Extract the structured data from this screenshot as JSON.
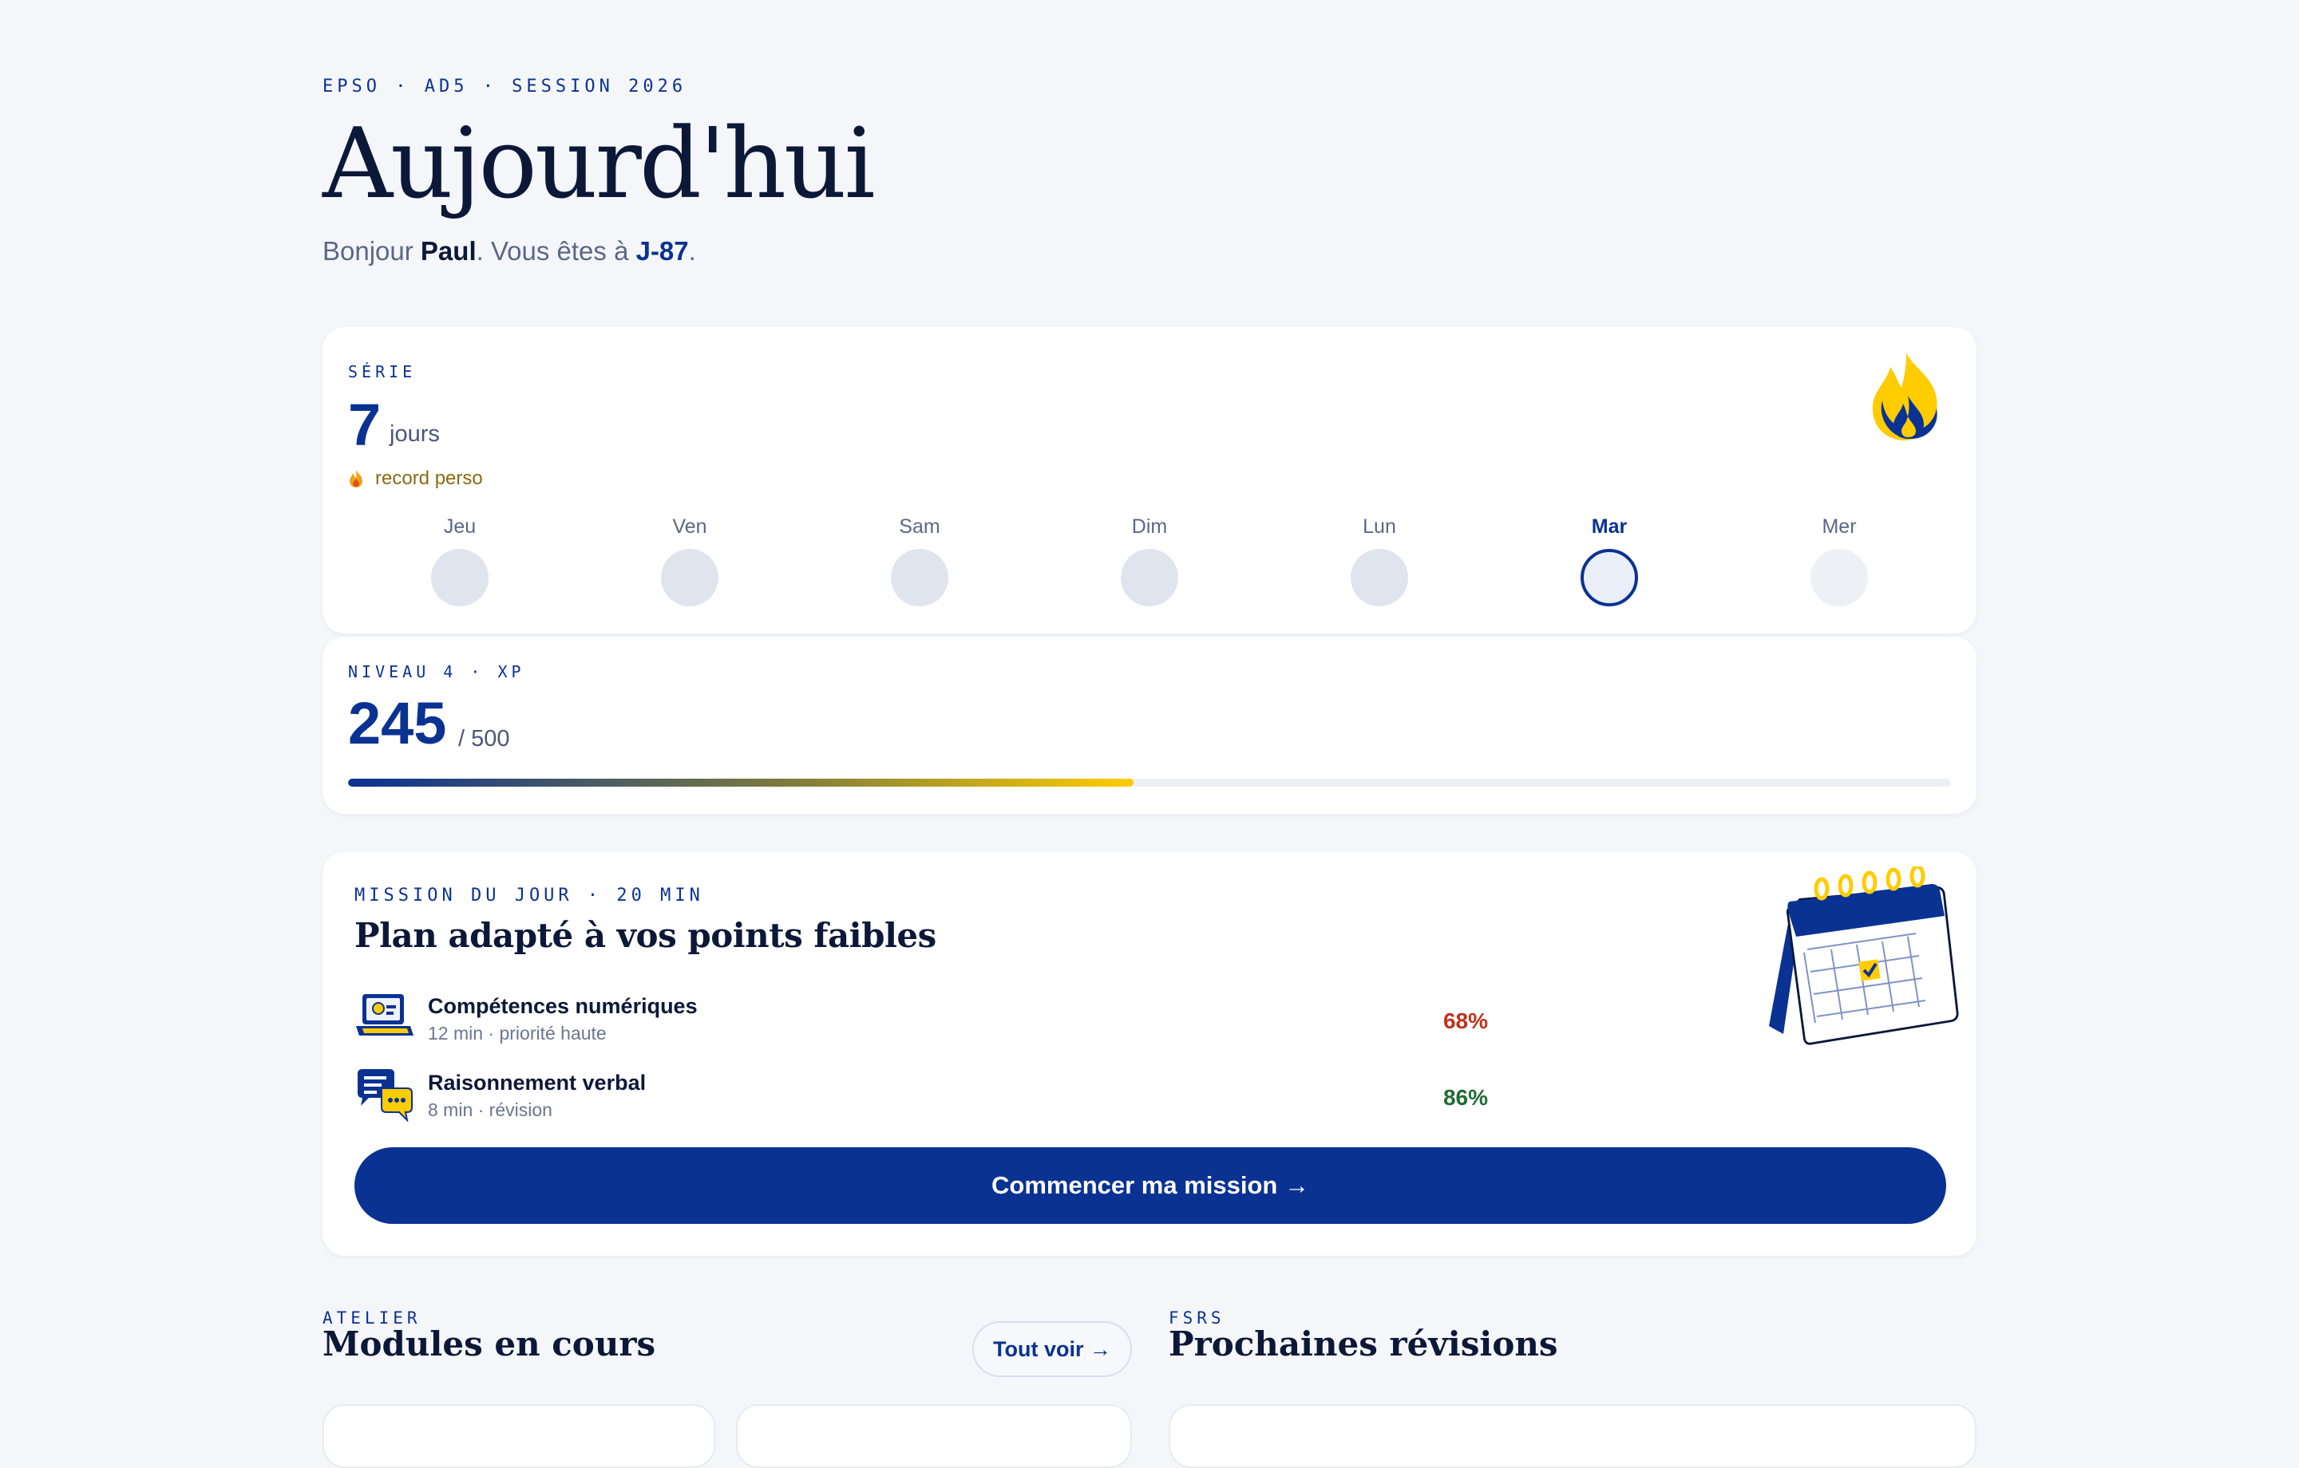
{
  "header": {
    "eyebrow": "EPSO · AD5 · SESSION 2026",
    "title": "Aujourd'hui",
    "greeting_prefix": "Bonjour ",
    "user_name": "Paul",
    "greeting_mid": ". Vous êtes à ",
    "countdown": "J-87",
    "greeting_suffix": "."
  },
  "streak": {
    "label": "SÉRIE",
    "count": "7",
    "unit": "jours",
    "record_label": "record perso",
    "days": [
      {
        "label": "Jeu",
        "state": "done"
      },
      {
        "label": "Ven",
        "state": "done"
      },
      {
        "label": "Sam",
        "state": "done"
      },
      {
        "label": "Dim",
        "state": "done"
      },
      {
        "label": "Lun",
        "state": "done"
      },
      {
        "label": "Mar",
        "state": "today"
      },
      {
        "label": "Mer",
        "state": "future"
      }
    ]
  },
  "xp": {
    "label": "NIVEAU 4 · XP",
    "current": "245",
    "max": "/ 500",
    "progress_fraction": 0.49
  },
  "mission": {
    "label": "MISSION DU JOUR · 20 MIN",
    "title": "Plan adapté à vos points faibles",
    "tasks": [
      {
        "name": "Compétences numériques",
        "meta": "12 min · priorité haute",
        "score": "68%",
        "score_color": "#c0321c",
        "icon": "laptop-icon"
      },
      {
        "name": "Raisonnement verbal",
        "meta": "8 min · révision",
        "score": "86%",
        "score_color": "#1e6b34",
        "icon": "chat-bubbles-icon"
      }
    ],
    "cta_label": "Commencer ma mission →"
  },
  "atelier": {
    "label": "ATELIER",
    "title": "Modules en cours",
    "see_all_label": "Tout voir →"
  },
  "fsrs": {
    "label": "FSRS",
    "title": "Prochaines révisions"
  },
  "colors": {
    "brand": "#0a3293",
    "accent": "#ffcc00",
    "background": "#f4f6fa"
  }
}
